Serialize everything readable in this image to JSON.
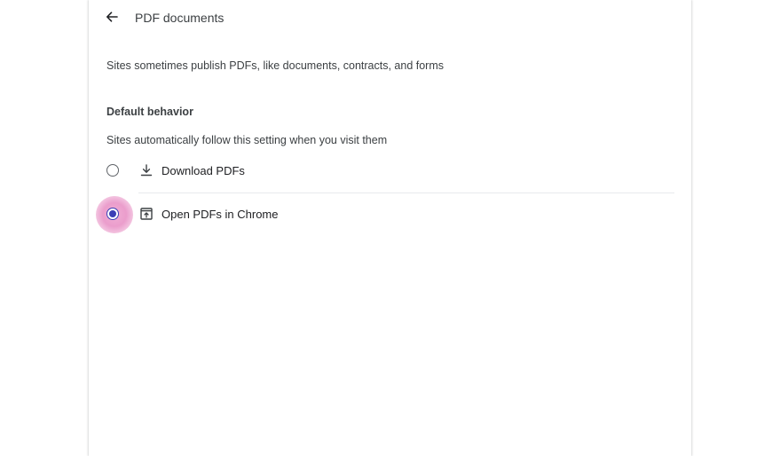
{
  "header": {
    "back_icon": "arrow-back-icon",
    "title": "PDF documents"
  },
  "description": "Sites sometimes publish PDFs, like documents, contracts, and forms",
  "default_behavior": {
    "heading": "Default behavior",
    "subheading": "Sites automatically follow this setting when you visit them",
    "options": [
      {
        "label": "Download PDFs",
        "icon": "download-icon",
        "selected": false
      },
      {
        "label": "Open PDFs in Chrome",
        "icon": "open-in-browser-icon",
        "selected": true
      }
    ]
  },
  "colors": {
    "accent": "#3b3fb6",
    "focus_halo": "#e78cc3"
  }
}
